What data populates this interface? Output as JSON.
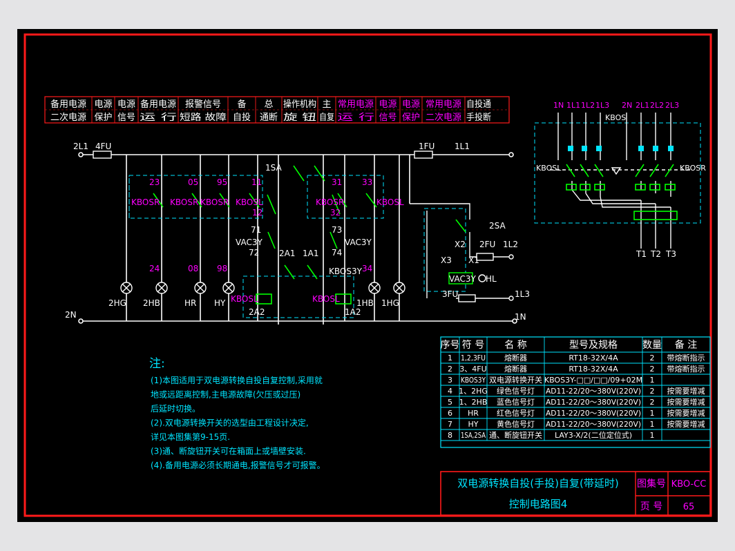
{
  "header_cells": [
    {
      "top": "备用电源",
      "bottom": "二次电源"
    },
    {
      "top": "电源",
      "bottom": "保护"
    },
    {
      "top": "电源",
      "bottom": "信号"
    },
    {
      "top": "备用电源",
      "bottom": "运   行"
    },
    {
      "top": "报警信号",
      "bottom": "短路  故障"
    },
    {
      "top": "备",
      "bottom": "自投"
    },
    {
      "top": "总",
      "bottom": "通断"
    },
    {
      "top": "操作机构",
      "bottom": "旋    钮"
    },
    {
      "top": "主",
      "bottom": "自复"
    },
    {
      "top": "常用电源",
      "bottom": "运   行"
    },
    {
      "top": "电源",
      "bottom": "信号"
    },
    {
      "top": "电源",
      "bottom": "保护"
    },
    {
      "top": "常用电源",
      "bottom": "二次电源"
    },
    {
      "top": "自投通",
      "bottom": "手投断"
    }
  ],
  "circuit_labels": {
    "fuse_left": "4FU",
    "fuse_right": "1FU",
    "line_2l1": "2L1",
    "line_1l1": "1L1",
    "line_2n": "2N",
    "line_1n": "1N",
    "line_1l2": "1L2",
    "line_1l3": "1L3",
    "switch_1sa": "1SA",
    "switch_2sa": "2SA",
    "fuse_2fu": "2FU",
    "fuse_3fu": "3FU",
    "relay_vac3y": "VAC3Y",
    "x2": "X2",
    "x3": "X3",
    "x1": "X1",
    "hl": "HL",
    "coil_left": "KBOSL",
    "coil_right": "KBOSL",
    "kb0s3y": "KBOS3Y",
    "n2a1": "2A1",
    "n1a1": "1A1",
    "n2a2": "2A2",
    "n1a2": "1A2",
    "n71": "71",
    "n72": "72",
    "n73": "73",
    "n74": "74",
    "c23": "23",
    "c05": "05",
    "c95": "95",
    "c11": "11",
    "c31": "31",
    "c33": "33",
    "c12": "12",
    "c32": "32",
    "c24": "24",
    "c08": "08",
    "c98": "98",
    "c34": "34",
    "kbosr1": "KBOSR",
    "kbosr2": "KBOSR",
    "kbosr3": "KBOSR",
    "kbosl1": "KBOSL",
    "kbosr4": "KBOSR",
    "kbosl2": "KBOSL",
    "lamp_2hg": "2HG",
    "lamp_2hb": "2HB",
    "lamp_hr": "HR",
    "lamp_hy": "HY",
    "lamp_1hb": "1HB",
    "lamp_1hg": "1HG"
  },
  "power_labels": {
    "top": [
      "1N",
      "1L1",
      "1L2",
      "1L3",
      "2N",
      "2L1",
      "2L2",
      "2L3"
    ],
    "kbos": "KBOS",
    "left": "KBOSL",
    "right": "KBOSR",
    "bottom": [
      "T1",
      "T2",
      "T3"
    ]
  },
  "notes": {
    "title": "注:",
    "lines": [
      "(1)本图适用于双电源转换自投自复控制,采用就",
      "   地或远距离控制,主电源故障(欠压或过压)",
      "   后延时切换。",
      "(2).双电源转换开关的选型由工程设计决定,",
      "   详见本图集第9-15页.",
      "(3)通、断旋钮开关可在箱面上或墙壁安装.",
      "(4).备用电源必须长期通电,报警信号才可报警。"
    ]
  },
  "bom": {
    "headers": [
      "序号",
      "符 号",
      "名 称",
      "型号及规格",
      "数量",
      "备 注"
    ],
    "rows": [
      [
        "1",
        "1,2,3FU",
        "熔断器",
        "RT18-32X/4A",
        "2",
        "带熔断指示"
      ],
      [
        "2",
        "3、4FU",
        "熔断器",
        "RT18-32X/4A",
        "2",
        "带熔断指示"
      ],
      [
        "3",
        "KBOS3Y",
        "双电源转换开关",
        "KBOS3Y-□□/□□/09+02M",
        "1",
        ""
      ],
      [
        "4",
        "1、2HG",
        "绿色信号灯",
        "AD11-22/20～380V(220V)",
        "2",
        "按需要增减"
      ],
      [
        "5",
        "1、2HB",
        "蓝色信号灯",
        "AD11-22/20～380V(220V)",
        "2",
        "按需要增减"
      ],
      [
        "6",
        "HR",
        "红色信号灯",
        "AD11-22/20～380V(220V)",
        "1",
        "按需要增减"
      ],
      [
        "7",
        "HY",
        "黄色信号灯",
        "AD11-22/20～380V(220V)",
        "1",
        "按需要增减"
      ],
      [
        "8",
        "1SA,2SA",
        "通、断旋钮开关",
        "LAY3-X/2(二位定位式)",
        "1",
        ""
      ]
    ]
  },
  "title_block": {
    "title_line1": "双电源转换自投(手投)自复(带延时)",
    "title_line2": "控制电路图4",
    "atlas_label": "图集号",
    "atlas_value": "KBO-CC",
    "page_label": "页 号",
    "page_value": "65"
  },
  "colors": {
    "background": "#000000",
    "frame": "#ff1a1a",
    "line": "#ffffff",
    "accent": "#00e5ff",
    "magenta": "#ff00ff",
    "green": "#00ff00",
    "yellow": "#ffff00",
    "text": "#ffffff"
  }
}
